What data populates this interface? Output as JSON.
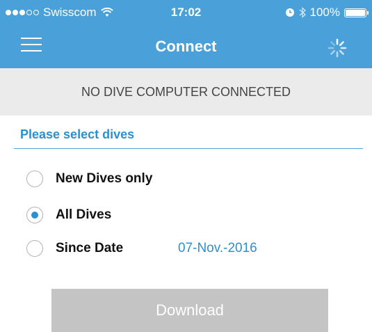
{
  "status_bar": {
    "carrier": "Swisscom",
    "time": "17:02",
    "battery": "100%",
    "signal_bars": 3,
    "icons": [
      "wifi-icon",
      "alarm-icon",
      "bluetooth-icon",
      "battery-icon"
    ]
  },
  "navbar": {
    "title": "Connect",
    "left_icon": "menu-icon",
    "right_icon": "spinner-icon"
  },
  "banner": {
    "text": "NO DIVE COMPUTER CONNECTED"
  },
  "section": {
    "title": "Please select dives"
  },
  "options": [
    {
      "label": "New Dives only",
      "checked": false
    },
    {
      "label": "All Dives",
      "checked": true
    },
    {
      "label": "Since Date",
      "checked": false,
      "value": "07-Nov.-2016"
    }
  ],
  "download_button": {
    "label": "Download"
  },
  "colors": {
    "accent": "#4aa0d8",
    "link": "#2d8fcf",
    "banner_bg": "#ebebeb",
    "button_disabled": "#c4c4c4"
  }
}
